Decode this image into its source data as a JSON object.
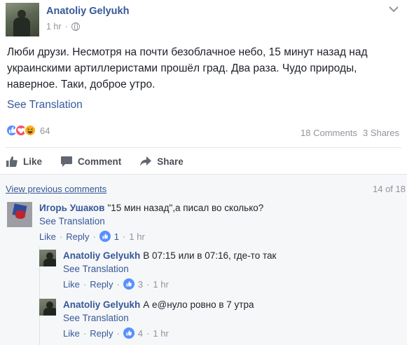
{
  "post": {
    "author": "Anatoliy Gelyukh",
    "time": "1 hr",
    "text": "Люби друзи. Несмотря на почти безоблачное небо, 15 минут назад над украинскими артиллеристами прошёл град. Два раза. Чудо природы, наверное. Таки, доброе утро.",
    "see_translation": "See Translation",
    "reaction_count": "64",
    "comments_count": "18 Comments",
    "shares_count": "3 Shares"
  },
  "actions": {
    "like": "Like",
    "comment": "Comment",
    "share": "Share"
  },
  "comments_section": {
    "view_previous": "View previous comments",
    "counter": "14 of 18"
  },
  "comments": [
    {
      "author": "Игорь Ушаков",
      "text": "\"15 мин назад\",а писал во сколько?",
      "see_translation": "See Translation",
      "like": "Like",
      "reply": "Reply",
      "likes": "1",
      "time": "1 hr"
    },
    {
      "author": "Anatoliy Gelyukh",
      "text": "В 07:15 или в 07:16, где-то так",
      "see_translation": "See Translation",
      "like": "Like",
      "reply": "Reply",
      "likes": "3",
      "time": "1 hr"
    },
    {
      "author": "Anatoliy Gelyukh",
      "text": "А е@нуло ровно в 7 утра",
      "see_translation": "See Translation",
      "like": "Like",
      "reply": "Reply",
      "likes": "4",
      "time": "1 hr"
    }
  ],
  "icons": [
    "globe-icon",
    "chevron-down-icon",
    "like-reaction-icon",
    "love-reaction-icon",
    "haha-reaction-icon",
    "thumbs-up-icon",
    "comment-icon",
    "share-icon"
  ],
  "colors": {
    "link": "#365899",
    "meta": "#90949c",
    "like_blue": "#5890ff",
    "love_red": "#f25268",
    "haha_yellow": "#f7b125"
  }
}
